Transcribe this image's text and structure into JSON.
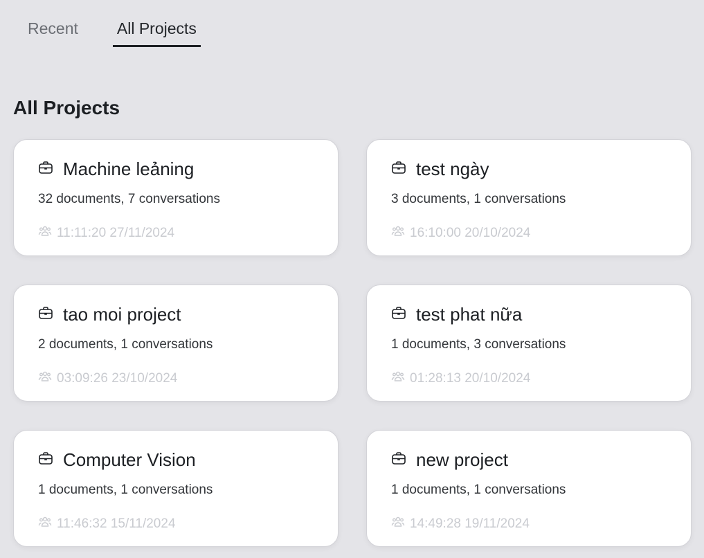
{
  "tabs": [
    {
      "label": "Recent"
    },
    {
      "label": "All Projects",
      "active": true
    }
  ],
  "heading": "All Projects",
  "projects": [
    {
      "name": "Machine leảning",
      "stats": "32 documents, 7 conversations",
      "time": "11:11:20 27/11/2024"
    },
    {
      "name": "test ngày",
      "stats": "3 documents, 1 conversations",
      "time": "16:10:00 20/10/2024"
    },
    {
      "name": "tao moi project",
      "stats": "2 documents, 1 conversations",
      "time": "03:09:26 23/10/2024"
    },
    {
      "name": "test phat nữa",
      "stats": "1 documents, 3 conversations",
      "time": "01:28:13 20/10/2024"
    },
    {
      "name": "Computer Vision",
      "stats": "1 documents, 1 conversations",
      "time": "11:46:32 15/11/2024"
    },
    {
      "name": "new project",
      "stats": "1 documents, 1 conversations",
      "time": "14:49:28 19/11/2024"
    }
  ]
}
